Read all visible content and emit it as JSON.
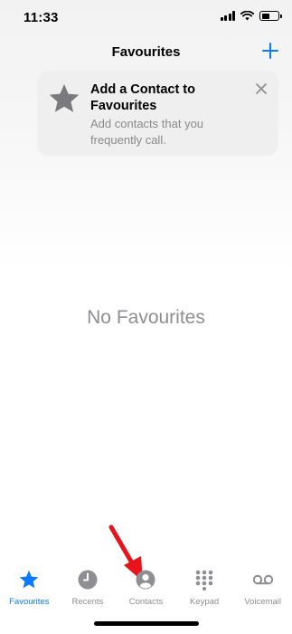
{
  "status_bar": {
    "time": "11:33"
  },
  "nav": {
    "title": "Favourites",
    "add_icon": "plus-icon"
  },
  "tip": {
    "title": "Add a Contact to Favourites",
    "body": "Add contacts that you frequently call.",
    "icon": "star-icon",
    "close_icon": "close-icon"
  },
  "empty_state": {
    "text": "No Favourites"
  },
  "tabs": [
    {
      "label": "Favourites",
      "icon": "star-icon",
      "active": true
    },
    {
      "label": "Recents",
      "icon": "clock-icon",
      "active": false
    },
    {
      "label": "Contacts",
      "icon": "person-circle-icon",
      "active": false
    },
    {
      "label": "Keypad",
      "icon": "keypad-icon",
      "active": false
    },
    {
      "label": "Voicemail",
      "icon": "voicemail-icon",
      "active": false
    }
  ],
  "colors": {
    "accent": "#0a7aff",
    "inactive": "#8e8e93",
    "annotation_arrow": "#e8141c",
    "card": "#efefef"
  }
}
